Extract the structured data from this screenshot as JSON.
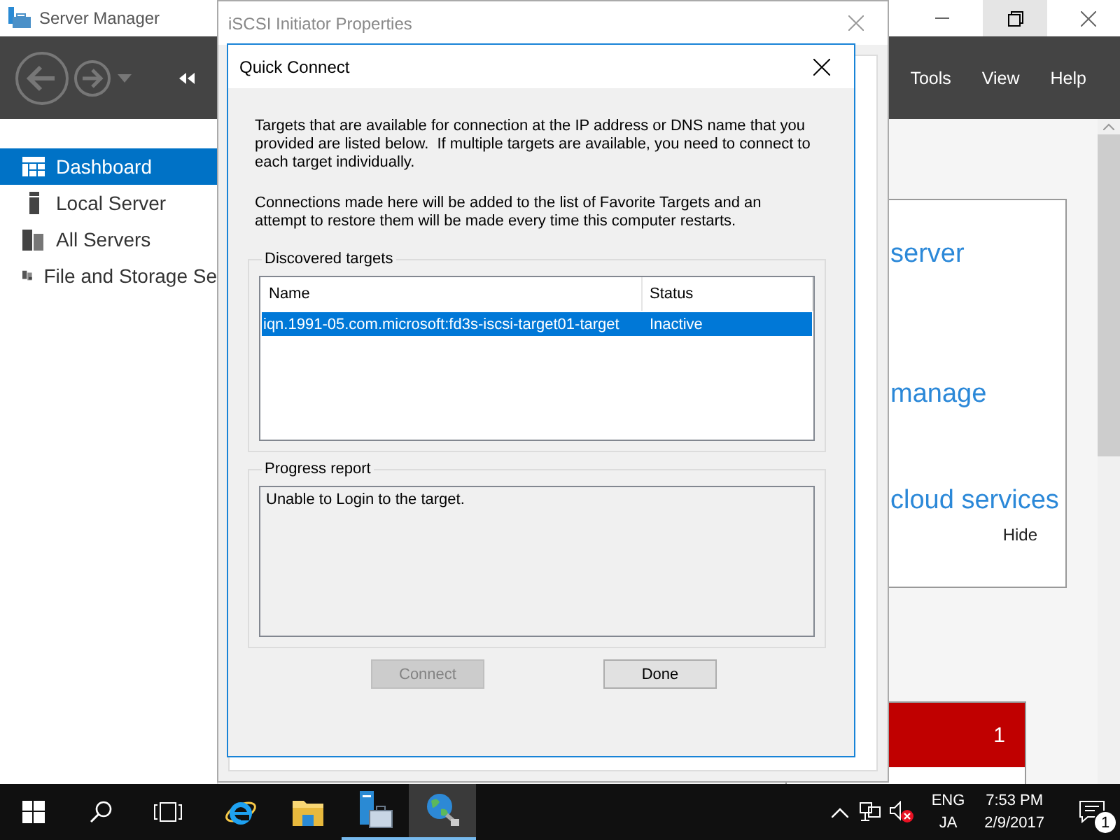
{
  "server_manager": {
    "title": "Server Manager",
    "menu": [
      "Tools",
      "View",
      "Help"
    ],
    "sidebar": {
      "items": [
        {
          "label": "Dashboard",
          "kind": "dashboard",
          "selected": true
        },
        {
          "label": "Local Server",
          "kind": "server",
          "selected": false
        },
        {
          "label": "All Servers",
          "kind": "servers",
          "selected": false
        },
        {
          "label": "File and Storage Se",
          "kind": "storage",
          "selected": false
        }
      ]
    },
    "welcome": {
      "lines": [
        "server",
        "manage",
        "cloud services"
      ],
      "hide_link": "Hide"
    },
    "tile": {
      "count": "1"
    }
  },
  "iscsi_window": {
    "title": "iSCSI Initiator Properties"
  },
  "quick_connect": {
    "title": "Quick Connect",
    "intro": "Targets that are available for connection at the IP address or DNS name that you provided are listed below.  If multiple targets are available, you need to connect to each target individually.",
    "note": "Connections made here will be added to the list of Favorite Targets and an attempt to restore them will be made every time this computer restarts.",
    "discovered": {
      "label": "Discovered targets",
      "columns": [
        "Name",
        "Status"
      ],
      "rows": [
        {
          "name": "iqn.1991-05.com.microsoft:fd3s-iscsi-target01-target",
          "status": "Inactive",
          "selected": true
        }
      ]
    },
    "progress": {
      "label": "Progress report",
      "text": "Unable to Login to the target."
    },
    "buttons": [
      {
        "label": "Connect",
        "disabled": true
      },
      {
        "label": "Done",
        "disabled": false
      }
    ]
  },
  "taskbar": {
    "apps": [
      {
        "kind": "ie",
        "running": false,
        "selected": false
      },
      {
        "kind": "explorer",
        "running": false,
        "selected": false
      },
      {
        "kind": "server-manager",
        "running": true,
        "selected": false
      },
      {
        "kind": "iscsi",
        "running": true,
        "selected": true
      }
    ],
    "language": [
      "ENG",
      "JA"
    ],
    "time": "7:53 PM",
    "date": "2/9/2017",
    "notification_count": "1"
  }
}
